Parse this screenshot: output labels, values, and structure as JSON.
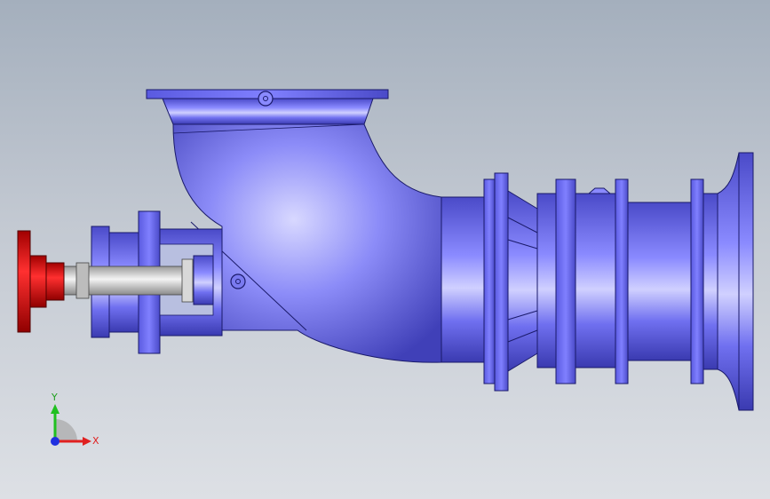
{
  "viewport": {
    "background_top": "#a4afbd",
    "background_bottom": "#dde0e5"
  },
  "model": {
    "body_color": "#6a6ae8",
    "body_dark": "#3a3ab0",
    "body_light": "#c8c8ff",
    "coupling_color": "#d01818",
    "shaft_color": "#c8c8c8"
  },
  "triad": {
    "x_label": "X",
    "y_label": "Y",
    "x_color": "#e02020",
    "y_color": "#20c020",
    "z_color": "#2030e0"
  }
}
